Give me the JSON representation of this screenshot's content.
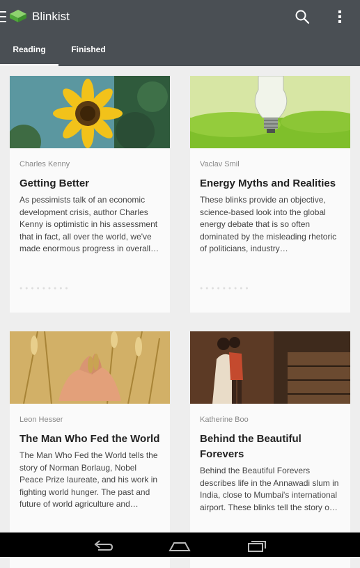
{
  "app": {
    "title": "Blinkist"
  },
  "tabs": [
    {
      "label": "Reading",
      "active": true
    },
    {
      "label": "Finished",
      "active": false
    }
  ],
  "cards": [
    {
      "author": "Charles Kenny",
      "title": "Getting Better",
      "description": "As pessimists talk of an economic development crisis, author Charles Kenny is optimistic in his assessment that in fact, all over the world, we've made enormous progress in overall…",
      "image": "sunflower"
    },
    {
      "author": "Vaclav Smil",
      "title": "Energy Myths and Realities",
      "description": "These blinks provide an objective, science-based look into the global energy debate that is so often dominated by the misleading rhetoric of politicians, industry…",
      "image": "lightbulb"
    },
    {
      "author": "Leon Hesser",
      "title": "The Man Who Fed the World",
      "description": "The Man Who Fed the World tells the story of Norman Borlaug, Nobel Peace Prize laureate, and his work in fighting world hunger. The past and future of world agriculture and…",
      "image": "wheat-hands"
    },
    {
      "author": "Katherine Boo",
      "title": "Behind the Beautiful Forevers",
      "description": "Behind the Beautiful Forevers describes life in the Annawadi slum in India, close to Mumbai's international airport. These blinks tell the story o…",
      "image": "mother-child"
    }
  ],
  "icons": {
    "menu": "menu-icon",
    "logo": "blinkist-logo-icon",
    "search": "search-icon",
    "more": "more-vert-icon",
    "back": "back-icon",
    "home": "home-icon",
    "recents": "recents-icon"
  },
  "colors": {
    "appbar": "#4a4f54",
    "logo_green": "#5fb944",
    "background": "#eeeeee",
    "card": "#fafafa"
  }
}
